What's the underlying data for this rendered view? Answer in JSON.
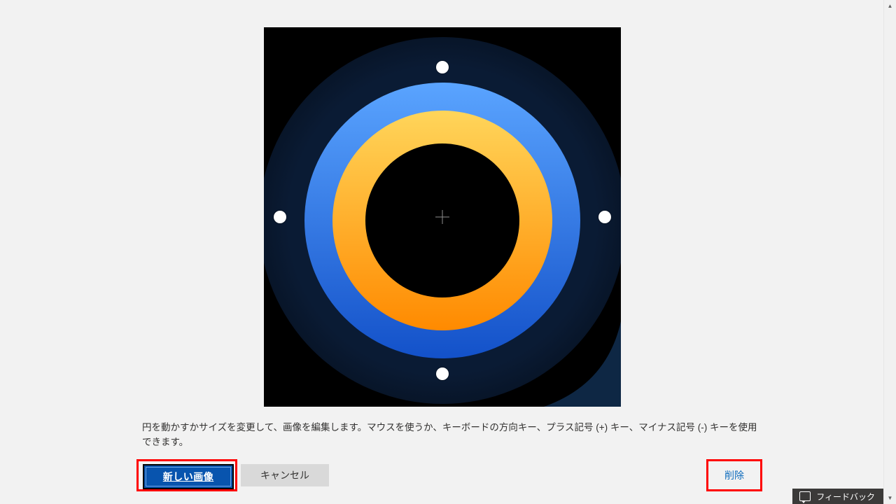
{
  "editor": {
    "center_icon": "crosshair-icon",
    "handle_top_icon": "resize-handle-icon",
    "handle_bottom_icon": "resize-handle-icon",
    "handle_left_icon": "resize-handle-icon",
    "handle_right_icon": "resize-handle-icon"
  },
  "instructions": "円を動かすかサイズを変更して、画像を編集します。マウスを使うか、キーボードの方向キー、プラス記号 (+) キー、マイナス記号 (-) キーを使用できます。",
  "buttons": {
    "new_image": "新しい画像",
    "cancel": "キャンセル",
    "delete": "削除"
  },
  "feedback": {
    "label": "フィードバック",
    "icon": "chat-bubble-icon"
  },
  "scrollbar": {
    "up_icon": "scroll-up-icon",
    "down_icon": "scroll-down-icon"
  },
  "colors": {
    "accent_primary": "#0854ae",
    "link": "#0f6cbd",
    "highlight": "#ff0000"
  }
}
